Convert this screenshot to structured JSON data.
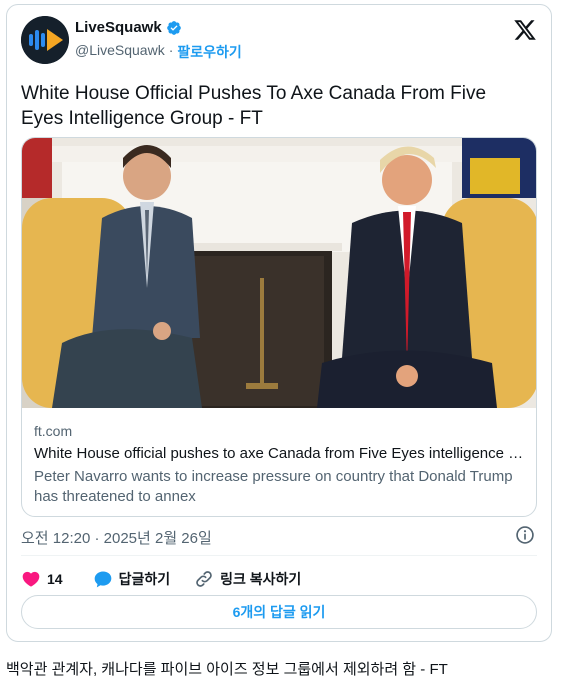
{
  "tweet": {
    "author_name": "LiveSquawk",
    "author_handle": "@LiveSquawk",
    "separator": "·",
    "follow_label": "팔로우하기",
    "text": "White House Official Pushes To Axe Canada From Five Eyes Intelligence Group - FT",
    "timestamp": "오전 12:20 · 2025년 2월 26일"
  },
  "link_card": {
    "domain": "ft.com",
    "title": "White House official pushes to axe Canada from Five Eyes intelligence gr...",
    "description": "Peter Navarro wants to increase pressure on country that Donald Trump has threatened to annex"
  },
  "actions": {
    "like_count": "14",
    "reply_label": "답글하기",
    "copy_link_label": "링크 복사하기",
    "read_replies_label": "6개의 답글 읽기"
  },
  "caption": "백악관 관계자, 캐나다를 파이브 아이즈 정보 그룹에서 제외하려 함 - FT",
  "colors": {
    "accent": "#1d9bf0",
    "like": "#f91880",
    "text": "#0f1419",
    "muted": "#536471",
    "border": "#cfd9de"
  },
  "icons": [
    "livesquawk-logo-icon",
    "verified-badge-icon",
    "x-logo-icon",
    "info-icon",
    "heart-icon",
    "reply-bubble-icon",
    "link-icon"
  ]
}
